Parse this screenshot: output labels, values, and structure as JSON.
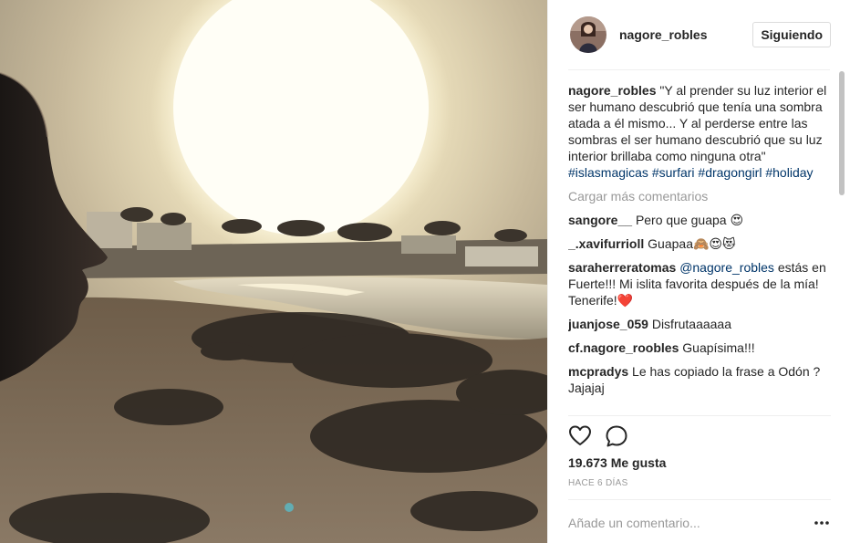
{
  "post": {
    "username": "nagore_robles",
    "follow_label": "Siguiendo",
    "caption": {
      "user": "nagore_robles",
      "text": "\"Y al prender su luz interior el ser humano descubrió que tenía una sombra atada a él mismo... Y al perderse entre las sombras el ser humano descubrió que su luz interior brillaba como ninguna otra\"",
      "hashtags": [
        "#islasmagicas",
        "#surfari",
        "#dragongirl",
        "#holiday"
      ]
    },
    "load_more_label": "Cargar más comentarios",
    "comments": [
      {
        "user": "sangore__",
        "text": "Pero que guapa 😍"
      },
      {
        "user": "_.xavifurrioll",
        "text": "Guapaa🙈😍😻"
      },
      {
        "user": "saraherreratomas",
        "mention": "@nagore_robles",
        "text": "estás en Fuerte!!! Mi islita favorita después de la mía! Tenerife!❤️"
      },
      {
        "user": "juanjose_059",
        "text": "Disfrutaaaaaa"
      },
      {
        "user": "cf.nagore_roobles",
        "text": "Guapísima!!!"
      },
      {
        "user": "mcpradys",
        "text": "Le has copiado la frase a Odón ? Jajajaj"
      }
    ],
    "likes_label": "19.673 Me gusta",
    "date_label": "HACE 6 DÍAS",
    "add_comment_placeholder": "Añade un comentario...",
    "icons": {
      "like": "heart-icon",
      "comment": "comment-icon",
      "options": "more-options-icon"
    },
    "colors": {
      "text": "#262626",
      "muted": "#999999",
      "hashtag": "#003569",
      "border": "#dbdbdb"
    }
  }
}
